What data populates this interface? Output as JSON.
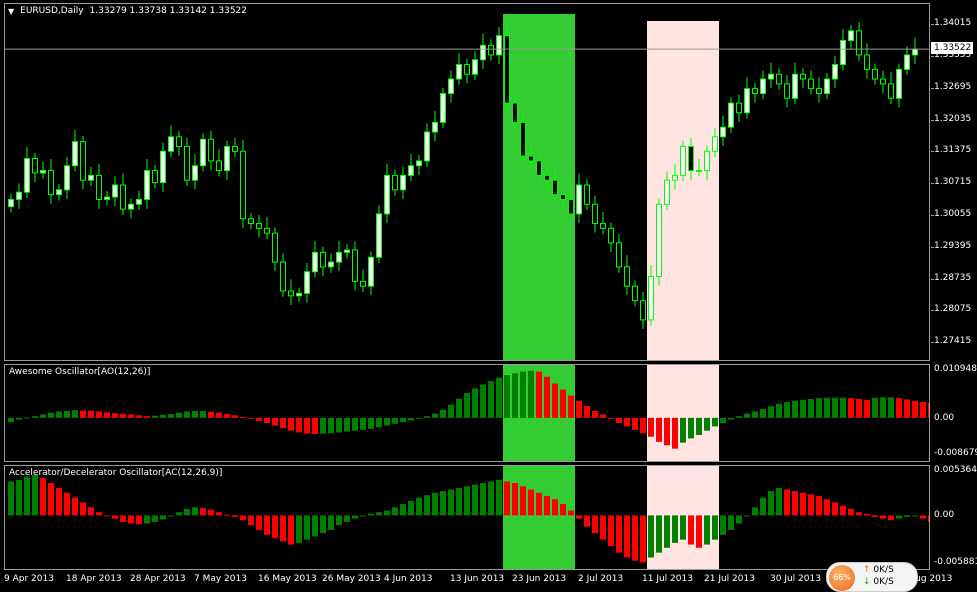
{
  "header": {
    "symbol": "EURUSD,Daily",
    "quote": "1.33279 1.33738 1.33142 1.33522",
    "menu_icon": "triangle-down-icon"
  },
  "main_price_axis": [
    "1.34015",
    "1.33355",
    "1.32695",
    "1.32035",
    "1.31375",
    "1.30715",
    "1.30055",
    "1.29395",
    "1.28735",
    "1.28075",
    "1.27415"
  ],
  "current_price_label": "1.33522",
  "ao_label": "Awesome Oscillator[AO(12,26)]",
  "ao_axis": [
    "0.010948",
    "0.00",
    "-0.008679"
  ],
  "ac_label": "Accelerator/Decelerator Oscillator[AC(12,26,9)]",
  "ac_axis": [
    "0.005364",
    "0.00",
    "-0.005881"
  ],
  "time_axis": [
    "9 Apr 2013",
    "18 Apr 2013",
    "28 Apr 2013",
    "7 May 2013",
    "16 May 2013",
    "26 May 2013",
    "4 Jun 2013",
    "13 Jun 2013",
    "23 Jun 2013",
    "2 Jul 2013",
    "11 Jul 2013",
    "21 Jul 2013",
    "30 Jul 2013",
    "Aug 2013"
  ],
  "status_widget": {
    "percent": "66%",
    "up_rate": "0K/S",
    "down_rate": "0K/S"
  },
  "colors": {
    "background": "#000000",
    "candle_body": "#ffffff",
    "candle_wick": "#00ff00",
    "bar_up": "#007f00",
    "bar_down": "#ff0000",
    "highlight_green": "#33cc33",
    "highlight_pink": "#ffe4e1"
  },
  "chart_data": [
    {
      "type": "candlestick",
      "title": "EURUSD,Daily",
      "ylim": [
        1.2715,
        1.3425
      ],
      "highlight_regions": [
        {
          "color": "green",
          "start_index": 62,
          "end_index": 70
        },
        {
          "color": "pink",
          "start_index": 80,
          "end_index": 88
        }
      ],
      "series": [
        {
          "values": [
            1.304,
            1.3055,
            1.3125,
            1.3095,
            1.31,
            1.305,
            1.306,
            1.311,
            1.316,
            1.308,
            1.309,
            1.304,
            1.3045,
            1.307,
            1.302,
            1.303,
            1.304,
            1.31,
            1.3075,
            1.314,
            1.317,
            1.315,
            1.308,
            1.311,
            1.3165,
            1.312,
            1.31,
            1.315,
            1.314,
            1.3,
            1.299,
            1.298,
            1.297,
            1.291,
            1.285,
            1.284,
            1.2845,
            1.289,
            1.293,
            1.29,
            1.291,
            1.293,
            1.2935,
            1.287,
            1.286,
            1.292,
            1.301,
            1.309,
            1.306,
            1.309,
            1.311,
            1.312,
            1.318,
            1.32,
            1.326,
            1.329,
            1.332,
            1.33,
            1.333,
            1.336,
            1.334,
            1.338,
            1.324,
            1.32,
            1.313,
            1.312,
            1.309,
            1.308,
            1.305,
            1.304,
            1.301,
            1.307,
            1.303,
            1.299,
            1.298,
            1.295,
            1.29,
            1.286,
            1.283,
            1.279,
            1.288,
            1.303,
            1.308,
            1.309,
            1.315,
            1.31,
            1.31,
            1.314,
            1.317,
            1.319,
            1.324,
            1.322,
            1.327,
            1.326,
            1.329,
            1.33,
            1.328,
            1.325,
            1.33,
            1.329,
            1.327,
            1.326,
            1.329,
            1.332,
            1.337,
            1.339,
            1.334,
            1.331,
            1.329,
            1.328,
            1.325,
            1.331,
            1.334,
            1.3352
          ]
        }
      ]
    },
    {
      "type": "bar",
      "title": "Awesome Oscillator[AO(12,26)]",
      "ylim": [
        -0.008679,
        0.010948
      ],
      "series": [
        {
          "values": [
            -0.001,
            -0.0004,
            0.0001,
            0.0004,
            0.0008,
            0.0012,
            0.0015,
            0.0016,
            0.0018,
            0.0017,
            0.0016,
            0.0015,
            0.0013,
            0.0011,
            0.0009,
            0.0008,
            0.0006,
            0.0004,
            0.0005,
            0.0007,
            0.0009,
            0.0012,
            0.0015,
            0.0016,
            0.0016,
            0.0014,
            0.0012,
            0.0009,
            0.0006,
            0.0002,
            -0.0002,
            -0.0007,
            -0.0012,
            -0.0018,
            -0.0024,
            -0.003,
            -0.0034,
            -0.0037,
            -0.0038,
            -0.0037,
            -0.0036,
            -0.0034,
            -0.0032,
            -0.003,
            -0.0028,
            -0.0026,
            -0.0022,
            -0.0018,
            -0.0014,
            -0.001,
            -0.0006,
            -0.0002,
            0.0004,
            0.001,
            0.0019,
            0.0031,
            0.0045,
            0.0058,
            0.0069,
            0.0078,
            0.0086,
            0.0094,
            0.01,
            0.0104,
            0.0108,
            0.011,
            0.0108,
            0.0096,
            0.008,
            0.0066,
            0.0052,
            0.004,
            0.0028,
            0.0016,
            0.0008,
            -0.0002,
            -0.0012,
            -0.002,
            -0.0028,
            -0.0036,
            -0.0044,
            -0.0056,
            -0.0064,
            -0.0072,
            -0.0058,
            -0.0048,
            -0.004,
            -0.003,
            -0.002,
            -0.0012,
            -0.0004,
            0.0004,
            0.001,
            0.0015,
            0.0021,
            0.0027,
            0.0033,
            0.0037,
            0.004,
            0.0042,
            0.0044,
            0.0046,
            0.0047,
            0.0047,
            0.0047,
            0.0046,
            0.0044,
            0.0042,
            0.0047,
            0.0048,
            0.0048,
            0.0046,
            0.0043,
            0.004,
            0.0037,
            0.0035,
            0.0034
          ]
        }
      ]
    },
    {
      "type": "bar",
      "title": "Accelerator/Decelerator Oscillator[AC(12,26,9)]",
      "ylim": [
        -0.005881,
        0.005364
      ],
      "series": [
        {
          "values": [
            0.0042,
            0.0044,
            0.0048,
            0.005,
            0.0046,
            0.004,
            0.0034,
            0.0028,
            0.0022,
            0.0016,
            0.001,
            0.0004,
            0.0,
            -0.0004,
            -0.0008,
            -0.001,
            -0.0011,
            -0.001,
            -0.0008,
            -0.0005,
            -0.0001,
            0.0004,
            0.0008,
            0.001,
            0.0009,
            0.0007,
            0.0004,
            0.0001,
            -0.0002,
            -0.0006,
            -0.0012,
            -0.0018,
            -0.0024,
            -0.0028,
            -0.0032,
            -0.0036,
            -0.0034,
            -0.003,
            -0.0026,
            -0.0022,
            -0.0018,
            -0.0012,
            -0.0008,
            -0.0004,
            -0.0001,
            0.0002,
            0.0004,
            0.0006,
            0.001,
            0.0014,
            0.0018,
            0.0022,
            0.0025,
            0.0028,
            0.003,
            0.0032,
            0.0034,
            0.0036,
            0.0038,
            0.004,
            0.0042,
            0.0044,
            0.0042,
            0.004,
            0.0036,
            0.0032,
            0.0028,
            0.0024,
            0.002,
            0.0014,
            0.0006,
            -0.0004,
            -0.0014,
            -0.0022,
            -0.003,
            -0.0038,
            -0.0046,
            -0.0052,
            -0.0056,
            -0.0058,
            -0.0052,
            -0.0046,
            -0.004,
            -0.0034,
            -0.003,
            -0.0036,
            -0.004,
            -0.0036,
            -0.003,
            -0.0024,
            -0.0018,
            -0.001,
            0.0,
            0.001,
            0.0022,
            0.003,
            0.0034,
            0.0032,
            0.003,
            0.0028,
            0.0026,
            0.0024,
            0.002,
            0.0016,
            0.0012,
            0.0008,
            0.0004,
            0.0002,
            -0.0002,
            -0.0004,
            -0.0006,
            -0.0004,
            -0.0002,
            0.0,
            -0.0004,
            -0.0008,
            -0.001
          ]
        }
      ]
    }
  ]
}
